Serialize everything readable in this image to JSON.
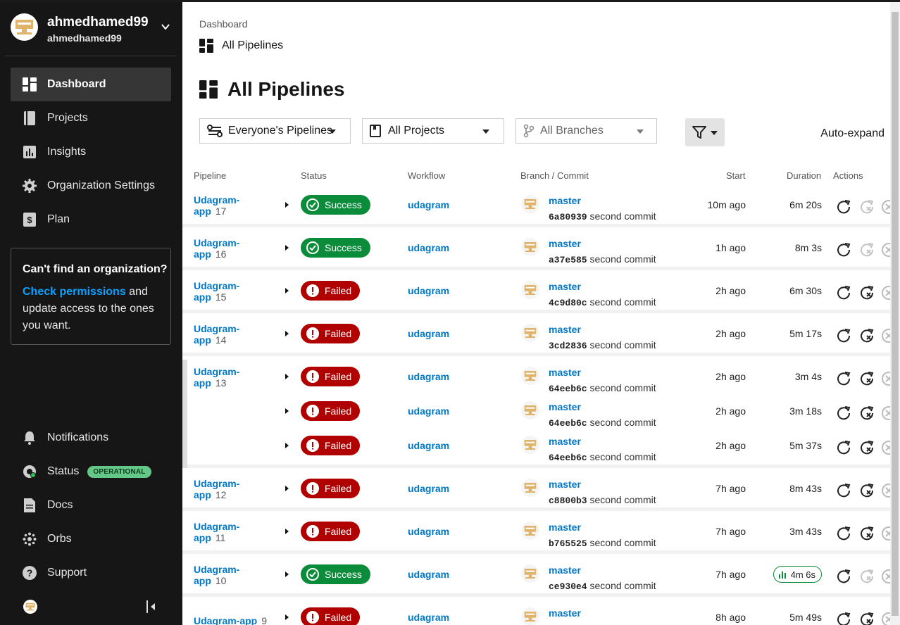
{
  "user": {
    "name": "ahmedhamed99",
    "org": "ahmedhamed99"
  },
  "nav": {
    "dashboard": "Dashboard",
    "projects": "Projects",
    "insights": "Insights",
    "org_settings": "Organization Settings",
    "plan": "Plan"
  },
  "help": {
    "question": "Can't find an organization?",
    "link": "Check permissions",
    "rest1": " and",
    "rest2": "update access to the ones",
    "rest3": "you want."
  },
  "bottom_nav": {
    "notifications": "Notifications",
    "status": "Status",
    "status_badge": "OPERATIONAL",
    "docs": "Docs",
    "orbs": "Orbs",
    "support": "Support"
  },
  "breadcrumb": "Dashboard",
  "subtitle": "All Pipelines",
  "page_title": "All Pipelines",
  "filters": {
    "pipelines": "Everyone's Pipelines",
    "projects": "All Projects",
    "branches": "All Branches",
    "auto_expand": "Auto-expand"
  },
  "columns": {
    "pipeline": "Pipeline",
    "status": "Status",
    "workflow": "Workflow",
    "branch": "Branch / Commit",
    "start": "Start",
    "duration": "Duration",
    "actions": "Actions"
  },
  "rows": [
    {
      "name1": "Udagram-",
      "name2": "app",
      "num": "17",
      "status": "Success",
      "workflow": "udagram",
      "branch": "master",
      "hash": "6a80939",
      "msg": "second commit",
      "start": "10m ago",
      "duration": "6m 20s"
    },
    {
      "name1": "Udagram-",
      "name2": "app",
      "num": "16",
      "status": "Success",
      "workflow": "udagram",
      "branch": "master",
      "hash": "a37e585",
      "msg": "second commit",
      "start": "1h ago",
      "duration": "8m 3s"
    },
    {
      "name1": "Udagram-",
      "name2": "app",
      "num": "15",
      "status": "Failed",
      "workflow": "udagram",
      "branch": "master",
      "hash": "4c9d80c",
      "msg": "second commit",
      "start": "2h ago",
      "duration": "6m 30s"
    },
    {
      "name1": "Udagram-",
      "name2": "app",
      "num": "14",
      "status": "Failed",
      "workflow": "udagram",
      "branch": "master",
      "hash": "3cd2836",
      "msg": "second commit",
      "start": "2h ago",
      "duration": "5m 17s"
    },
    {
      "name1": "Udagram-",
      "name2": "app",
      "num": "13",
      "status": "Failed",
      "workflow": "udagram",
      "branch": "master",
      "hash": "64eeb6c",
      "msg": "second commit",
      "start": "2h ago",
      "duration": "3m 4s"
    },
    {
      "status": "Failed",
      "workflow": "udagram",
      "branch": "master",
      "hash": "64eeb6c",
      "msg": "second commit",
      "start": "2h ago",
      "duration": "3m 18s"
    },
    {
      "status": "Failed",
      "workflow": "udagram",
      "branch": "master",
      "hash": "64eeb6c",
      "msg": "second commit",
      "start": "2h ago",
      "duration": "5m 37s"
    },
    {
      "name1": "Udagram-",
      "name2": "app",
      "num": "12",
      "status": "Failed",
      "workflow": "udagram",
      "branch": "master",
      "hash": "c8800b3",
      "msg": "second commit",
      "start": "7h ago",
      "duration": "8m 43s"
    },
    {
      "name1": "Udagram-",
      "name2": "app",
      "num": "11",
      "status": "Failed",
      "workflow": "udagram",
      "branch": "master",
      "hash": "b765525",
      "msg": "second commit",
      "start": "7h ago",
      "duration": "3m 43s"
    },
    {
      "name1": "Udagram-",
      "name2": "app",
      "num": "10",
      "status": "Success",
      "workflow": "udagram",
      "branch": "master",
      "hash": "ce930e4",
      "msg": "second commit",
      "start": "7h ago",
      "duration": "4m 6s"
    },
    {
      "name1": "Udagram-app",
      "num": "9",
      "status": "Failed",
      "workflow": "udagram",
      "branch": "master",
      "start": "8h ago",
      "duration": "5m 49s"
    }
  ],
  "colors": {
    "success": "#0a8c3a",
    "failed": "#b00000",
    "link": "#0078c8",
    "sidebar": "#161616"
  }
}
